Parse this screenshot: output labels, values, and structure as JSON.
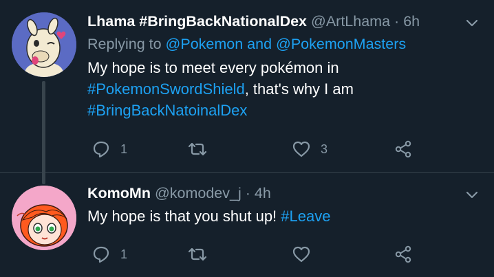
{
  "tweets": [
    {
      "name": "Lhama #BringBackNationalDex",
      "handle": "@ArtLhama",
      "separator": "·",
      "time": "6h",
      "replying_prefix": "Replying to ",
      "replying_to": "@Pokemon and @PokemonMasters",
      "text_parts": [
        "My hope is to meet every pokémon in ",
        "#PokemonSwordShield",
        ", that's why I am ",
        "#BringBackNatoinalDex"
      ],
      "reply_count": "1",
      "retweet_count": "",
      "like_count": "3",
      "avatar_icon": "llama-avatar-icon"
    },
    {
      "name": "KomoMn",
      "handle": "@komodev_j",
      "separator": "·",
      "time": "4h",
      "text_parts": [
        "My hope is that you shut up! ",
        "#Leave"
      ],
      "reply_count": "1",
      "retweet_count": "",
      "like_count": "",
      "avatar_icon": "red-hair-character-avatar-icon"
    }
  ],
  "colors": {
    "background": "#15202b",
    "link": "#1da1f2",
    "muted": "#8899a6",
    "divider": "#38444d"
  }
}
